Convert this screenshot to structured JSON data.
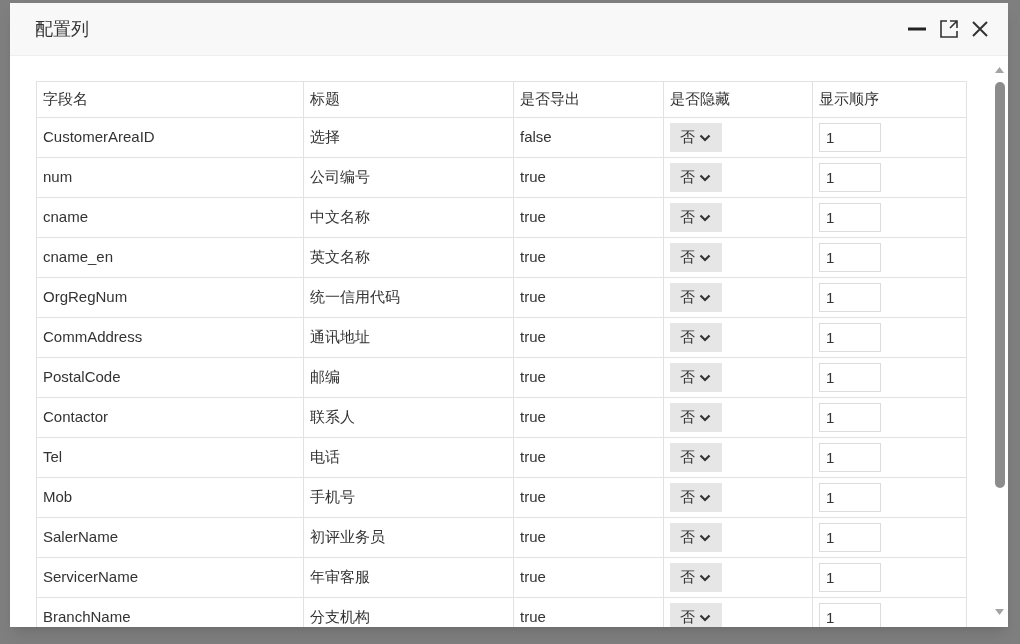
{
  "dialog": {
    "title": "配置列"
  },
  "table": {
    "columns": [
      "字段名",
      "标题",
      "是否导出",
      "是否隐藏",
      "显示顺序"
    ],
    "rows": [
      {
        "field": "CustomerAreaID",
        "title": "选择",
        "export": "false",
        "hidden": "否",
        "order": "1"
      },
      {
        "field": "num",
        "title": "公司编号",
        "export": "true",
        "hidden": "否",
        "order": "1"
      },
      {
        "field": "cname",
        "title": "中文名称",
        "export": "true",
        "hidden": "否",
        "order": "1"
      },
      {
        "field": "cname_en",
        "title": "英文名称",
        "export": "true",
        "hidden": "否",
        "order": "1"
      },
      {
        "field": "OrgRegNum",
        "title": "统一信用代码",
        "export": "true",
        "hidden": "否",
        "order": "1"
      },
      {
        "field": "CommAddress",
        "title": "通讯地址",
        "export": "true",
        "hidden": "否",
        "order": "1"
      },
      {
        "field": "PostalCode",
        "title": "邮编",
        "export": "true",
        "hidden": "否",
        "order": "1"
      },
      {
        "field": "Contactor",
        "title": "联系人",
        "export": "true",
        "hidden": "否",
        "order": "1"
      },
      {
        "field": "Tel",
        "title": "电话",
        "export": "true",
        "hidden": "否",
        "order": "1"
      },
      {
        "field": "Mob",
        "title": "手机号",
        "export": "true",
        "hidden": "否",
        "order": "1"
      },
      {
        "field": "SalerName",
        "title": "初评业务员",
        "export": "true",
        "hidden": "否",
        "order": "1"
      },
      {
        "field": "ServicerName",
        "title": "年审客服",
        "export": "true",
        "hidden": "否",
        "order": "1"
      },
      {
        "field": "BranchName",
        "title": "分支机构",
        "export": "true",
        "hidden": "否",
        "order": "1"
      }
    ]
  }
}
